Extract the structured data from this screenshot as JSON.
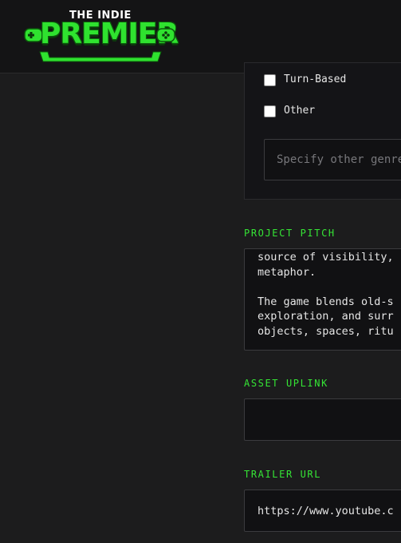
{
  "brand": {
    "top_text": "THE INDIE",
    "main_text": "PREMIER"
  },
  "genres": {
    "options": [
      {
        "label": "Turn-Based",
        "checked": false
      },
      {
        "label": "Other",
        "checked": false
      }
    ],
    "other_placeholder": "Specify other genre"
  },
  "pitch": {
    "label": "PROJECT PITCH",
    "lines": [
      "source of visibility,",
      "metaphor.",
      "",
      "The game blends old-s",
      "exploration, and surr",
      "objects, spaces, ritu"
    ]
  },
  "asset": {
    "label": "ASSET UPLINK",
    "value": ""
  },
  "trailer": {
    "label": "TRAILER URL",
    "value": "https://www.youtube.c"
  },
  "colors": {
    "accent": "#35e535",
    "background": "#1c1c1d",
    "header": "#141415"
  }
}
